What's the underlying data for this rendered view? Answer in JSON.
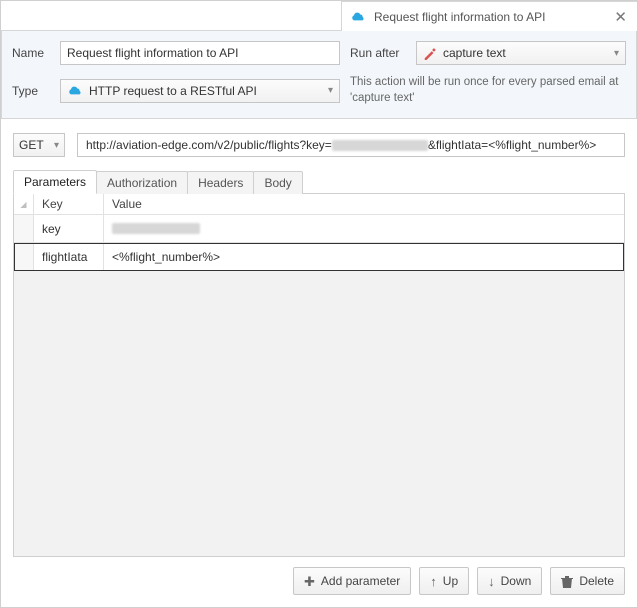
{
  "window": {
    "title": "Request flight information to API"
  },
  "form": {
    "name_label": "Name",
    "name_value": "Request flight information to API",
    "type_label": "Type",
    "type_value": "HTTP request to a RESTful API",
    "runafter_label": "Run after",
    "runafter_value": "capture text",
    "run_note": "This action will be run once for every parsed email at 'capture text'"
  },
  "request": {
    "method": "GET",
    "url_prefix": "http://aviation-edge.com/v2/public/flights?key=",
    "url_suffix": "&flightIata=<%flight_number%>"
  },
  "tabs": {
    "parameters": "Parameters",
    "authorization": "Authorization",
    "headers": "Headers",
    "body": "Body"
  },
  "params_table": {
    "header_key": "Key",
    "header_value": "Value",
    "rows": [
      {
        "key": "key",
        "value": "",
        "blurred": true
      },
      {
        "key": "flightIata",
        "value": "<%flight_number%>"
      }
    ]
  },
  "buttons": {
    "add": "Add parameter",
    "up": "Up",
    "down": "Down",
    "delete": "Delete"
  }
}
